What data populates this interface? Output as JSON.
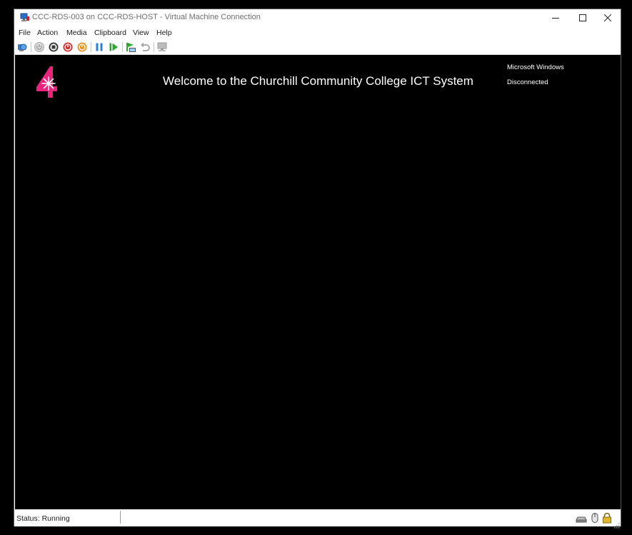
{
  "window": {
    "title": "CCC-RDS-003 on CCC-RDS-HOST - Virtual Machine Connection"
  },
  "menu": [
    "File",
    "Action",
    "Media",
    "Clipboard",
    "View",
    "Help"
  ],
  "toolbar": {
    "icons": [
      "ctrl-alt-del-icon",
      "start-icon",
      "turn-off-icon",
      "shutdown-icon",
      "save-icon",
      "pause-icon",
      "resume-icon",
      "checkpoint-icon",
      "revert-icon",
      "enhanced-session-icon"
    ]
  },
  "screen": {
    "welcome": "Welcome to the Churchill Community College ICT System",
    "os_label": "Microsoft Windows",
    "state": "Disconnected",
    "logo_color": "#e8247d"
  },
  "status": {
    "text": "Status: Running"
  }
}
